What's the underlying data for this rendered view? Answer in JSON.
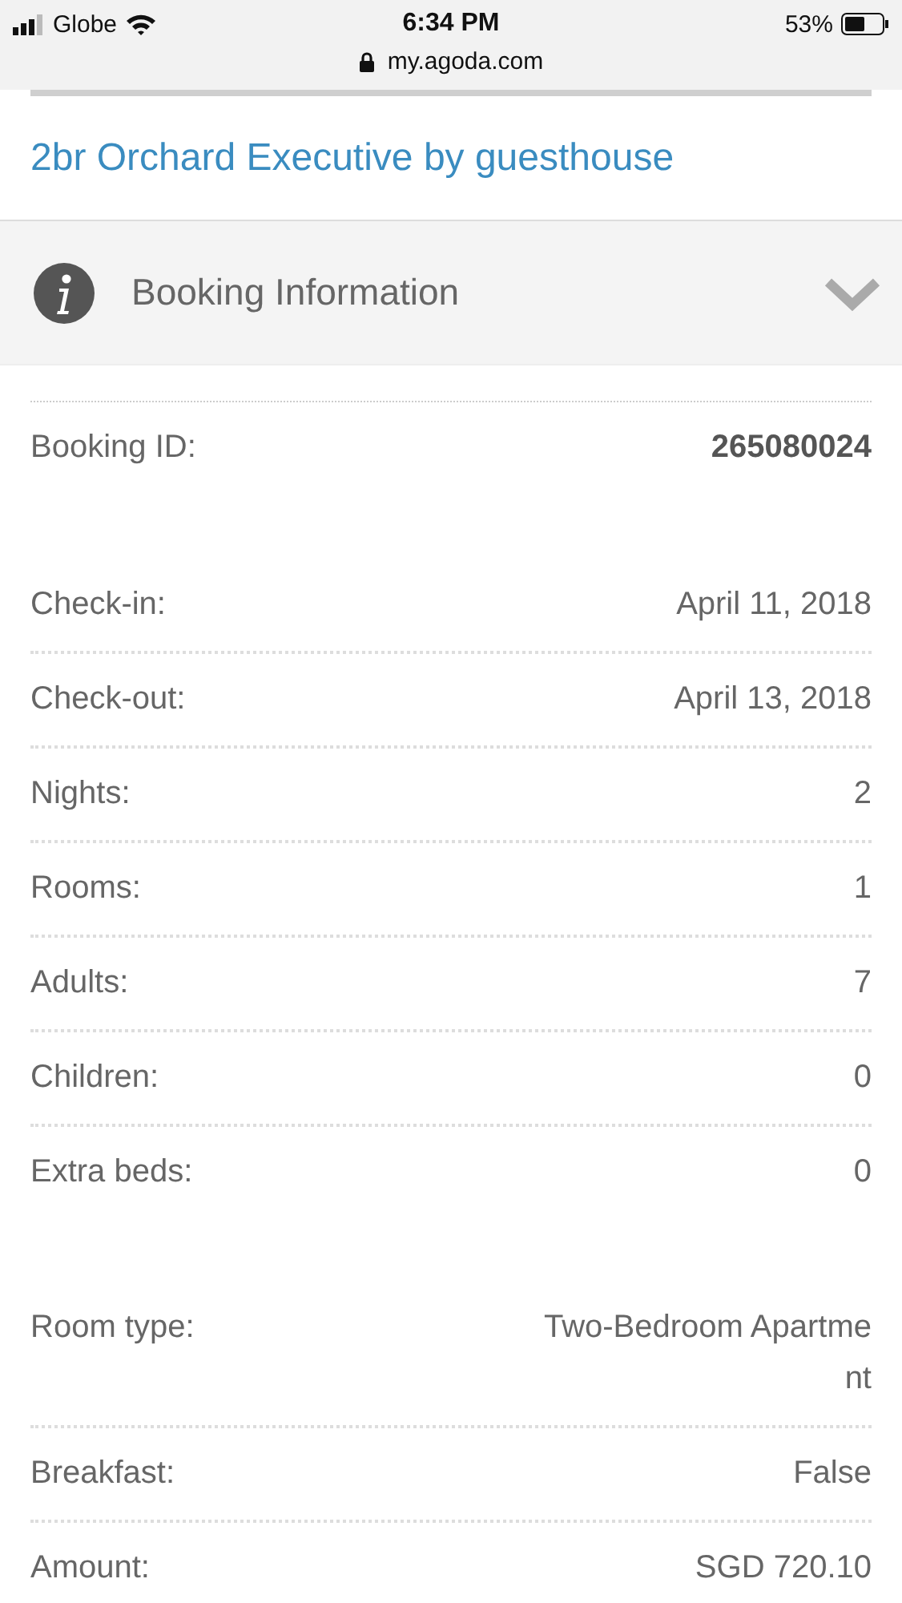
{
  "status_bar": {
    "carrier": "Globe",
    "time": "6:34 PM",
    "battery": "53%",
    "url": "my.agoda.com"
  },
  "property_title": "2br Orchard Executive by guesthouse",
  "section": {
    "title": "Booking Information",
    "expanded": true
  },
  "groups": [
    {
      "rows": [
        {
          "label": "Booking ID:",
          "value": "265080024",
          "emphasis": true
        }
      ]
    },
    {
      "rows": [
        {
          "label": "Check-in:",
          "value": "April 11, 2018",
          "emphasis": false
        },
        {
          "label": "Check-out:",
          "value": "April 13, 2018",
          "emphasis": false
        },
        {
          "label": "Nights:",
          "value": "2",
          "emphasis": false
        },
        {
          "label": "Rooms:",
          "value": "1",
          "emphasis": false
        },
        {
          "label": "Adults:",
          "value": "7",
          "emphasis": false
        },
        {
          "label": "Children:",
          "value": "0",
          "emphasis": false
        },
        {
          "label": "Extra beds:",
          "value": "0",
          "emphasis": false
        }
      ]
    },
    {
      "rows": [
        {
          "label": "Room type:",
          "value": "Two-Bedroom Apartment",
          "emphasis": false
        },
        {
          "label": "Breakfast:",
          "value": "False",
          "emphasis": false
        },
        {
          "label": "Amount:",
          "value": "SGD 720.10",
          "emphasis": false
        }
      ]
    }
  ]
}
